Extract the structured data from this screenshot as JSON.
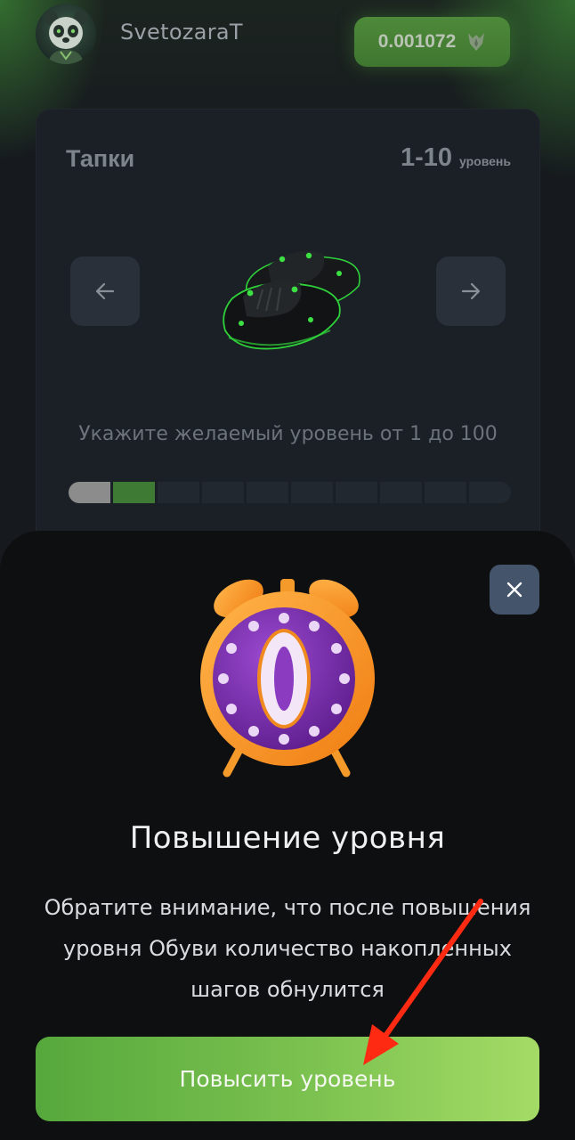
{
  "header": {
    "username": "SvetozaraT",
    "balance": "0.001072",
    "balance_icon": "token-icon",
    "avatar": "panda-avatar"
  },
  "card": {
    "title": "Тапки",
    "level_range": "1-10",
    "level_unit": "уровень",
    "hint": "Укажите желаемый уровень от 1 до 100",
    "progress": {
      "segments_total": 10,
      "segments_done": 1,
      "segment_current": 2
    },
    "colors": {
      "done": "#8c8c8c",
      "current": "#3f7a34",
      "empty": "#22282f"
    }
  },
  "sheet": {
    "title": "Повышение уровня",
    "message": "Обратите внимание, что после повышения уровня Обуви количество накопленных шагов обнулится",
    "cta_label": "Повысить уровень",
    "clock_digit": "0",
    "accent": "#7cc250"
  }
}
